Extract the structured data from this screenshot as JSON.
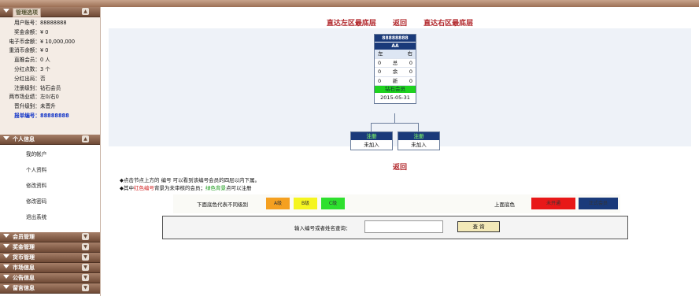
{
  "sidebar": {
    "account_header": "管理选项",
    "info": [
      {
        "label": "用户账号：",
        "value": "88888888"
      },
      {
        "label": "奖金余额：",
        "value": "¥ 0"
      },
      {
        "label": "电子币余额：",
        "value": "¥ 10,000,000"
      },
      {
        "label": "重消币余额：",
        "value": "¥ 0"
      },
      {
        "label": "直推会员：",
        "value": "0 人"
      },
      {
        "label": "分红点数：",
        "value": "3 个"
      },
      {
        "label": "分红出局：",
        "value": "否"
      },
      {
        "label": "注册级别：",
        "value": "钻石会员"
      },
      {
        "label": "两市场业绩：",
        "value": "左0/右0"
      },
      {
        "label": "晋升级别：",
        "value": "未晋升"
      },
      {
        "label": "报单编号：",
        "value": "88888888"
      }
    ],
    "personal_header": "个人信息",
    "menu": [
      "我的帐户",
      "个人资料",
      "修改资料",
      "修改密码",
      "退出系统"
    ],
    "sections": [
      "会员管理",
      "奖金管理",
      "货币管理",
      "市场信息",
      "公告信息",
      "留言信息"
    ]
  },
  "top_links": {
    "left": "直达左区最底层",
    "back": "返回",
    "right": "直达右区最底层"
  },
  "root_node": {
    "id": "88888888",
    "name": "AA",
    "left_label": "左",
    "right_label": "右",
    "rows": [
      [
        "0",
        "总",
        "0"
      ],
      [
        "0",
        "余",
        "0"
      ],
      [
        "0",
        "新",
        "0"
      ]
    ],
    "level": "钻石会员",
    "date": "2015-05-31"
  },
  "children": [
    {
      "status": "注册",
      "action": "未加入"
    },
    {
      "status": "注册",
      "action": "未加入"
    }
  ],
  "bottom_back": "返回",
  "notes": {
    "line1": "◆点击节点上方的 编号 可以看到该编号会员的四层以内下属。",
    "line2_a": "◆其中",
    "line2_red": "红色编号",
    "line2_b": "背景为未审核的会员；",
    "line2_green": "绿色背景",
    "line2_c": "点可以注册"
  },
  "legend": {
    "levels_label": "下面底色代表不同级别",
    "levels": [
      {
        "label": "A级",
        "color": "#f5a020"
      },
      {
        "label": "B级",
        "color": "#f5f520"
      },
      {
        "label": "C级",
        "color": "#2ee02e"
      }
    ],
    "top_label": "上面底色",
    "status": [
      {
        "label": "未开通",
        "color": "#e81818"
      },
      {
        "label": "正式会员",
        "color": "#1a3a7a"
      }
    ]
  },
  "search": {
    "label": "输入编号或者姓名查询：",
    "value": "",
    "button": "查 询"
  }
}
